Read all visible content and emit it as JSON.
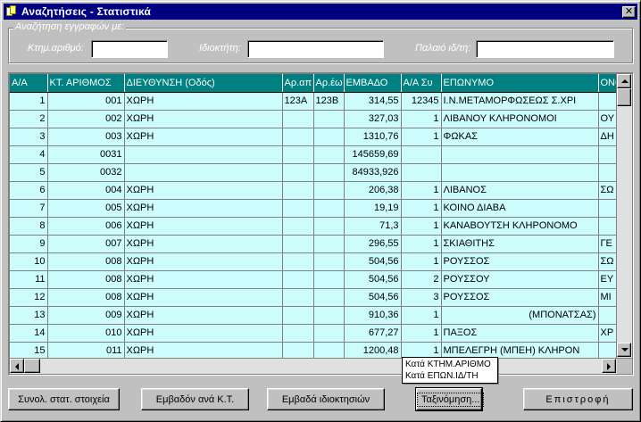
{
  "window": {
    "title": "Αναζητήσεις - Στατιστικά",
    "close_glyph": "✕"
  },
  "search": {
    "legend": "Αναζήτηση εγγραφών με:",
    "fields": [
      {
        "label": "Κτημ.αριθμό:",
        "value": "",
        "placeholder": ""
      },
      {
        "label": "Ιδιοκτήτη:",
        "value": "",
        "placeholder": ""
      },
      {
        "label": "Παλαιό ιδ/τη:",
        "value": "",
        "placeholder": ""
      }
    ]
  },
  "grid": {
    "columns": [
      "Α/Α",
      "ΚΤ. ΑΡΙΘΜΟΣ",
      "ΔΙΕΥΘΥΝΣΗ (Οδός)",
      "Αρ.απ",
      "Αρ.έω",
      "ΕΜΒΑΔΟ",
      "Α/Α Συ",
      "ΕΠΩΝΥΜΟ",
      "ΟΝΟ"
    ],
    "rows": [
      [
        "1",
        "001",
        "ΧΩΡΗ",
        "123Α",
        "123Β",
        "314,55",
        "12345",
        "Ι.Ν.ΜΕΤΑΜΟΡΦΩΣΕΩΣ Σ.ΧΡΙ",
        ""
      ],
      [
        "2",
        "002",
        "ΧΩΡΗ",
        "",
        "",
        "327,03",
        "1",
        "ΛΙΒΑΝΟΥ ΚΛΗΡΟΝΟΜΟΙ",
        "ΟΥ"
      ],
      [
        "3",
        "003",
        "ΧΩΡΗ",
        "",
        "",
        "1310,76",
        "1",
        "ΦΩΚΑΣ",
        "ΔΗ"
      ],
      [
        "4",
        "0031",
        "",
        "",
        "",
        "145659,69",
        "",
        "",
        ""
      ],
      [
        "5",
        "0032",
        "",
        "",
        "",
        "84933,926",
        "",
        "",
        ""
      ],
      [
        "6",
        "004",
        "ΧΩΡΗ",
        "",
        "",
        "206,38",
        "1",
        "ΛΙΒΑΝΟΣ",
        "ΣΩ"
      ],
      [
        "7",
        "005",
        "ΧΩΡΗ",
        "",
        "",
        "19,19",
        "1",
        "ΚΟΙΝΟ ΔΙΑΒΑ",
        ""
      ],
      [
        "8",
        "006",
        "ΧΩΡΗ",
        "",
        "",
        "71,3",
        "1",
        "ΚΑΝΑΒΟΥΤΣΗ ΚΛΗΡΟΝΟΜΟ",
        ""
      ],
      [
        "9",
        "007",
        "ΧΩΡΗ",
        "",
        "",
        "296,55",
        "1",
        "ΣΚΙΑΘΙΤΗΣ",
        "ΓΕ"
      ],
      [
        "10",
        "008",
        "ΧΩΡΗ",
        "",
        "",
        "504,56",
        "1",
        "ΡΟΥΣΣΟΣ",
        "ΣΩ"
      ],
      [
        "11",
        "008",
        "ΧΩΡΗ",
        "",
        "",
        "504,56",
        "2",
        "ΡΟΥΣΣΟΥ",
        "ΕΥ"
      ],
      [
        "12",
        "008",
        "ΧΩΡΗ",
        "",
        "",
        "504,56",
        "3",
        "ΡΟΥΣΣΟΣ",
        "ΜΙ"
      ],
      [
        "13",
        "009",
        "ΧΩΡΗ",
        "",
        "",
        "910,36",
        "1",
        "(ΜΠΟΝΑΤΣΑΣ)",
        ""
      ],
      [
        "14",
        "010",
        "ΧΩΡΗ",
        "",
        "",
        "677,27",
        "1",
        "ΠΑΞΟΣ",
        "ΧΡ"
      ],
      [
        "15",
        "011",
        "ΧΩΡΗ",
        "",
        "",
        "1200,48",
        "1",
        "ΜΠΕΛΕΓΡΗ (ΜΠΕΗ) ΚΛΗΡΟΝ",
        ""
      ]
    ]
  },
  "sort_popup": {
    "items": [
      "Κατά ΚΤΗΜ.ΑΡΙΘΜΟ",
      "Κατά ΕΠΩΝ.ΙΔ/ΤΗ"
    ]
  },
  "buttons": {
    "summary": "Συνολ. στατ. στοιχεία",
    "area_per_kt": "Εμβαδόν ανά Κ.Τ.",
    "owner_areas": "Εμβαδά ιδιοκτησιών",
    "sort": "Ταξινόμηση...",
    "back": "Επιστροφή"
  },
  "colors": {
    "titlebar": "#000080",
    "grid_header": "#008080",
    "grid_cell": "#ccfcfc",
    "face": "#c0c0c0"
  }
}
